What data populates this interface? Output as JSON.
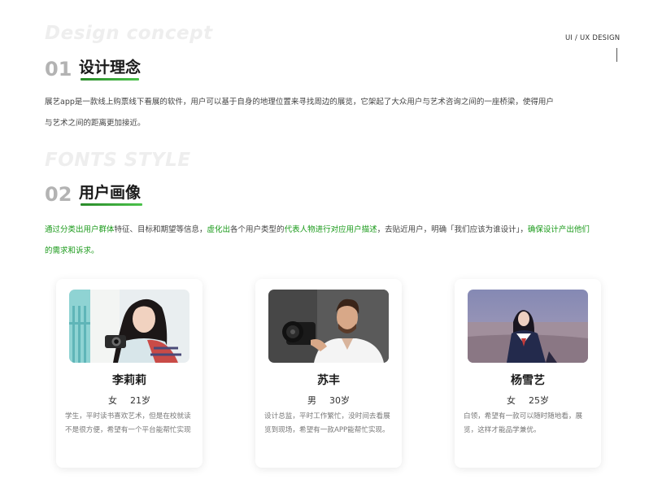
{
  "header": {
    "tag": "UI / UX DESIGN"
  },
  "section1": {
    "ghost": "Design concept",
    "number": "01",
    "title": "设计理念",
    "line1": "展艺app是一款线上购票线下看展的软件，用户可以基于自身的地理位置来寻找周边的展览，它架起了大众用户与艺术咨询之间的一座桥梁，使得用户",
    "line2": "与艺术之间的距离更加接近。"
  },
  "section2": {
    "ghost": "FONTS STYLE",
    "number": "02",
    "title": "用户画像",
    "segments": [
      "通过分类出用户群体",
      "特征、目标和期望等信息，",
      "虚化出",
      "各个用户类型的",
      "代表人物进行对应用户描述",
      "，去贴近用户，明确「我们应该为谁设计」，",
      "确保设计产出他们的需求和诉求。"
    ]
  },
  "personas": [
    {
      "name": "李莉莉",
      "gender": "女",
      "age": "21岁",
      "desc": "学生，平时读书喜欢艺术，但是在校就读不是很方便，希望有一个平台能帮忙实现",
      "photo": "young-woman-with-camera-photo"
    },
    {
      "name": "苏丰",
      "gender": "男",
      "age": "30岁",
      "desc": "设计总监，平时工作繁忙，没时间去看展览到现场，希望有一款APP能帮忙实现。",
      "photo": "man-with-camera-photo"
    },
    {
      "name": "杨雪艺",
      "gender": "女",
      "age": "25岁",
      "desc": "白领，希望有一款可以随时随地看，展览，这样才能品学兼优。",
      "photo": "woman-at-seaside-photo"
    }
  ],
  "colors": {
    "accent_green": "#1a9a1a",
    "ghost_text": "#eeeeee",
    "number_gray": "#b3b3b3"
  }
}
